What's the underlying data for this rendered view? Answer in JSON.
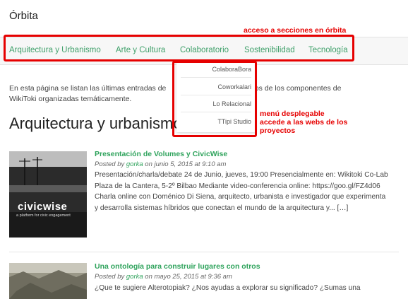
{
  "site": {
    "title": "Órbita"
  },
  "nav": {
    "items": [
      {
        "label": "Arquitectura y Urbanismo"
      },
      {
        "label": "Arte y Cultura"
      },
      {
        "label": "Colaboratorio"
      },
      {
        "label": "Sostenibilidad"
      },
      {
        "label": "Tecnología"
      }
    ]
  },
  "annotations": {
    "nav_label": "acceso a secciones en órbita",
    "dropdown_label_line1": "menú desplegable",
    "dropdown_label_line2": "accede a las webs de los",
    "dropdown_label_line3": "proyectos"
  },
  "dropdown": {
    "items": [
      {
        "label": "ColaboraBora"
      },
      {
        "label": "Coworkalari"
      },
      {
        "label": "Lo Relacional"
      },
      {
        "label": "TTipi Studio"
      }
    ]
  },
  "intro": {
    "line1_start": "En esta página se listan las últimas entradas de",
    "line1_end": "activos de los componentes de",
    "line2": "WikiToki organizadas temáticamente."
  },
  "section": {
    "heading": "Arquitectura y urbanismo"
  },
  "posts": [
    {
      "title": "Presentación de Volumes y CivicWise",
      "meta_prefix": "Posted by",
      "author": "gorka",
      "date": "on junio 5, 2015 at 9:10 am",
      "excerpt": "Presentación/charla/debate 24 de Junio, jueves, 19:00 Presencialmente en: Wikitoki Co-Lab Plaza de la Cantera, 5-2º Bilbao Mediante video-conferencia online: https://goo.gl/FZ4d06   Charla online con Doménico Di Siena, arquitecto, urbanista e investigador que experimenta y desarrolla sistemas híbridos que conectan el mundo de la arquitectura y... […]",
      "thumb_brand": "civicwise",
      "thumb_tagline": "a platform for civic engagement"
    },
    {
      "title": "Una ontología para construir lugares con otros",
      "meta_prefix": "Posted by",
      "author": "gorka",
      "date": "on mayo 25, 2015 at 9:36 am",
      "excerpt": "¿Que te sugiere Alterotopiak? ¿Nos ayudas a explorar su significado? ¿Sumas una"
    }
  ],
  "colors": {
    "accent": "#3fa06a",
    "annotation": "#e60000",
    "link": "#2fa35c"
  }
}
